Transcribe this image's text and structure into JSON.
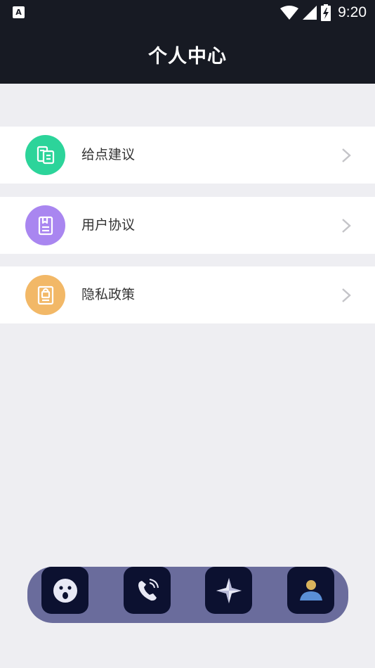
{
  "status_bar": {
    "app_badge": "A",
    "time": "9:20"
  },
  "header": {
    "title": "个人中心"
  },
  "menu": [
    {
      "label": "给点建议",
      "icon": "suggestion-icon",
      "color": "#2cd49a"
    },
    {
      "label": "用户协议",
      "icon": "agreement-icon",
      "color": "#a986f0"
    },
    {
      "label": "隐私政策",
      "icon": "privacy-lock-icon",
      "color": "#f2b867"
    }
  ],
  "dock": {
    "background": "#6a6c9c",
    "items": [
      {
        "icon": "surprised-face-icon"
      },
      {
        "icon": "phone-icon"
      },
      {
        "icon": "compass-diamond-icon"
      },
      {
        "icon": "user-profile-icon"
      }
    ]
  },
  "colors": {
    "header_bg": "#171a23",
    "page_bg": "#eeeef2"
  }
}
